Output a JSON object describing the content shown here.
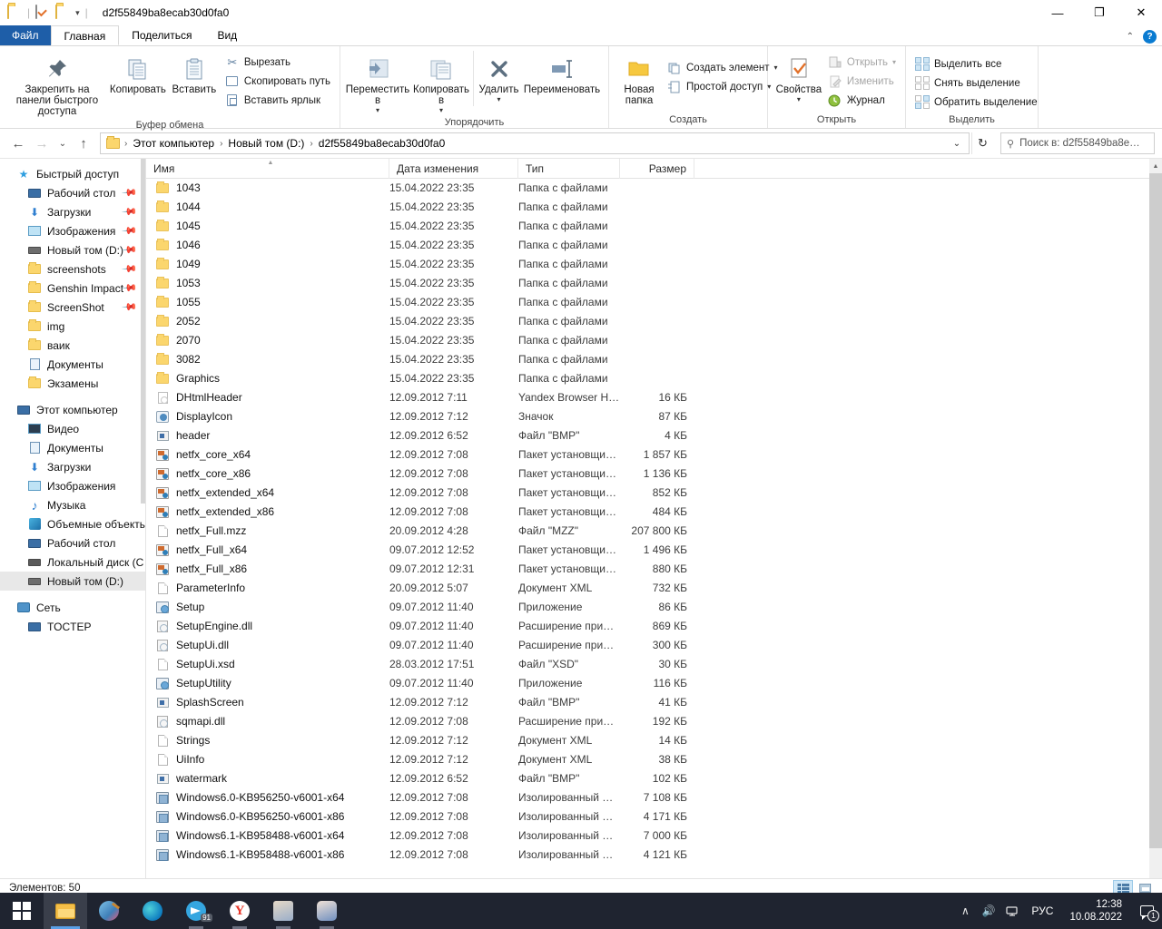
{
  "window": {
    "title": "d2f55849ba8ecab30d0fa0",
    "minimize": "—",
    "maximize": "❐",
    "close": "✕",
    "ribbon_collapse": "⌃",
    "help": "?"
  },
  "quick_access": {
    "folder_icon": "folder-icon",
    "properties_icon": "properties-icon",
    "new_folder_icon": "new-folder-icon",
    "customize_caret": "▾",
    "sep": "|"
  },
  "tabs": [
    {
      "label": "Файл",
      "name": "tab-file"
    },
    {
      "label": "Главная",
      "name": "tab-home"
    },
    {
      "label": "Поделиться",
      "name": "tab-share"
    },
    {
      "label": "Вид",
      "name": "tab-view"
    }
  ],
  "ribbon": {
    "groups": [
      {
        "name": "clipboard",
        "label": "Буфер обмена",
        "big": [
          {
            "label": "Закрепить на панели быстрого доступа",
            "icon": "pin-icon"
          },
          {
            "label": "Копировать",
            "icon": "copy-icon"
          },
          {
            "label": "Вставить",
            "icon": "paste-icon"
          }
        ],
        "small": [
          {
            "label": "Вырезать",
            "icon": "scissors-icon"
          },
          {
            "label": "Скопировать путь",
            "icon": "copy-path-icon"
          },
          {
            "label": "Вставить ярлык",
            "icon": "paste-shortcut-icon"
          }
        ]
      },
      {
        "name": "organize",
        "label": "Упорядочить",
        "big": [
          {
            "label": "Переместить в",
            "icon": "move-to-icon",
            "caret": "▾"
          },
          {
            "label": "Копировать в",
            "icon": "copy-to-icon",
            "caret": "▾"
          },
          {
            "label": "Удалить",
            "icon": "delete-icon",
            "caret": "▾"
          },
          {
            "label": "Переименовать",
            "icon": "rename-icon"
          }
        ]
      },
      {
        "name": "new",
        "label": "Создать",
        "big": [
          {
            "label": "Новая папка",
            "icon": "new-folder-icon"
          }
        ],
        "small": [
          {
            "label": "Создать элемент",
            "icon": "new-item-icon",
            "caret": "▾"
          },
          {
            "label": "Простой доступ",
            "icon": "easy-access-icon",
            "caret": "▾"
          }
        ]
      },
      {
        "name": "open",
        "label": "Открыть",
        "big": [
          {
            "label": "Свойства",
            "icon": "properties-icon",
            "caret": "▾"
          }
        ],
        "small": [
          {
            "label": "Открыть",
            "icon": "open-icon",
            "caret": "▾",
            "disabled": true
          },
          {
            "label": "Изменить",
            "icon": "edit-icon",
            "disabled": true
          },
          {
            "label": "Журнал",
            "icon": "history-icon"
          }
        ]
      },
      {
        "name": "select",
        "label": "Выделить",
        "small": [
          {
            "label": "Выделить все",
            "icon": "select-all-icon"
          },
          {
            "label": "Снять выделение",
            "icon": "select-none-icon"
          },
          {
            "label": "Обратить выделение",
            "icon": "invert-selection-icon"
          }
        ]
      }
    ]
  },
  "navbar": {
    "back_icon": "←",
    "forward_icon": "→",
    "recent_icon": "⌄",
    "up_icon": "↑",
    "breadcrumbs": [
      "Этот компьютер",
      "Новый том (D:)",
      "d2f55849ba8ecab30d0fa0"
    ],
    "sep": "›",
    "dropdown_icon": "⌄",
    "refresh_icon": "↻"
  },
  "search": {
    "placeholder": "Поиск в: d2f55849ba8e…",
    "icon": "search-icon"
  },
  "sidebar": {
    "groups": [
      {
        "name": "quick-access",
        "header": {
          "label": "Быстрый доступ",
          "icon": "star-icon"
        },
        "items": [
          {
            "label": "Рабочий стол",
            "icon": "desktop-icon",
            "pinned": true
          },
          {
            "label": "Загрузки",
            "icon": "downloads-icon",
            "pinned": true
          },
          {
            "label": "Изображения",
            "icon": "pictures-icon",
            "pinned": true
          },
          {
            "label": "Новый том (D:)",
            "icon": "drive-icon",
            "pinned": true
          },
          {
            "label": "screenshots",
            "icon": "folder-icon",
            "pinned": true
          },
          {
            "label": "Genshin Impact",
            "icon": "folder-icon",
            "pinned": true
          },
          {
            "label": "ScreenShot",
            "icon": "folder-icon",
            "pinned": true
          },
          {
            "label": "img",
            "icon": "folder-icon",
            "pinned": false
          },
          {
            "label": "ваик",
            "icon": "folder-icon",
            "pinned": false
          },
          {
            "label": "Документы",
            "icon": "documents-icon",
            "pinned": false
          },
          {
            "label": "Экзамены",
            "icon": "folder-icon",
            "pinned": false
          }
        ]
      },
      {
        "name": "this-pc",
        "header": {
          "label": "Этот компьютер",
          "icon": "pc-icon"
        },
        "items": [
          {
            "label": "Видео",
            "icon": "videos-icon"
          },
          {
            "label": "Документы",
            "icon": "documents-icon"
          },
          {
            "label": "Загрузки",
            "icon": "downloads-icon"
          },
          {
            "label": "Изображения",
            "icon": "pictures-icon"
          },
          {
            "label": "Музыка",
            "icon": "music-icon"
          },
          {
            "label": "Объемные объекты",
            "icon": "3d-objects-icon"
          },
          {
            "label": "Рабочий стол",
            "icon": "desktop-icon"
          },
          {
            "label": "Локальный диск (C",
            "icon": "local-disk-icon"
          },
          {
            "label": "Новый том (D:)",
            "icon": "drive-icon",
            "selected": true
          }
        ]
      },
      {
        "name": "network",
        "header": {
          "label": "Сеть",
          "icon": "network-icon"
        },
        "items": [
          {
            "label": "TOCTEP",
            "icon": "pc-icon"
          }
        ]
      }
    ]
  },
  "filelist": {
    "columns": [
      {
        "label": "Имя",
        "key": "name",
        "sorted": true
      },
      {
        "label": "Дата изменения",
        "key": "date"
      },
      {
        "label": "Тип",
        "key": "type"
      },
      {
        "label": "Размер",
        "key": "size"
      }
    ],
    "rows": [
      {
        "name": "1043",
        "date": "15.04.2022 23:35",
        "type": "Папка с файлами",
        "size": "",
        "icon": "folder"
      },
      {
        "name": "1044",
        "date": "15.04.2022 23:35",
        "type": "Папка с файлами",
        "size": "",
        "icon": "folder"
      },
      {
        "name": "1045",
        "date": "15.04.2022 23:35",
        "type": "Папка с файлами",
        "size": "",
        "icon": "folder"
      },
      {
        "name": "1046",
        "date": "15.04.2022 23:35",
        "type": "Папка с файлами",
        "size": "",
        "icon": "folder"
      },
      {
        "name": "1049",
        "date": "15.04.2022 23:35",
        "type": "Папка с файлами",
        "size": "",
        "icon": "folder"
      },
      {
        "name": "1053",
        "date": "15.04.2022 23:35",
        "type": "Папка с файлами",
        "size": "",
        "icon": "folder"
      },
      {
        "name": "1055",
        "date": "15.04.2022 23:35",
        "type": "Папка с файлами",
        "size": "",
        "icon": "folder"
      },
      {
        "name": "2052",
        "date": "15.04.2022 23:35",
        "type": "Папка с файлами",
        "size": "",
        "icon": "folder"
      },
      {
        "name": "2070",
        "date": "15.04.2022 23:35",
        "type": "Папка с файлами",
        "size": "",
        "icon": "folder"
      },
      {
        "name": "3082",
        "date": "15.04.2022 23:35",
        "type": "Папка с файлами",
        "size": "",
        "icon": "folder"
      },
      {
        "name": "Graphics",
        "date": "15.04.2022 23:35",
        "type": "Папка с файлами",
        "size": "",
        "icon": "folder"
      },
      {
        "name": "DHtmlHeader",
        "date": "12.09.2012 7:11",
        "type": "Yandex Browser H…",
        "size": "16 КБ",
        "icon": "html"
      },
      {
        "name": "DisplayIcon",
        "date": "12.09.2012 7:12",
        "type": "Значок",
        "size": "87 КБ",
        "icon": "ico"
      },
      {
        "name": "header",
        "date": "12.09.2012 6:52",
        "type": "Файл \"BMP\"",
        "size": "4 КБ",
        "icon": "bmp"
      },
      {
        "name": "netfx_core_x64",
        "date": "12.09.2012 7:08",
        "type": "Пакет установщи…",
        "size": "1 857 КБ",
        "icon": "msi"
      },
      {
        "name": "netfx_core_x86",
        "date": "12.09.2012 7:08",
        "type": "Пакет установщи…",
        "size": "1 136 КБ",
        "icon": "msi"
      },
      {
        "name": "netfx_extended_x64",
        "date": "12.09.2012 7:08",
        "type": "Пакет установщи…",
        "size": "852 КБ",
        "icon": "msi"
      },
      {
        "name": "netfx_extended_x86",
        "date": "12.09.2012 7:08",
        "type": "Пакет установщи…",
        "size": "484 КБ",
        "icon": "msi"
      },
      {
        "name": "netfx_Full.mzz",
        "date": "20.09.2012 4:28",
        "type": "Файл \"MZZ\"",
        "size": "207 800 КБ",
        "icon": "doc"
      },
      {
        "name": "netfx_Full_x64",
        "date": "09.07.2012 12:52",
        "type": "Пакет установщи…",
        "size": "1 496 КБ",
        "icon": "msi"
      },
      {
        "name": "netfx_Full_x86",
        "date": "09.07.2012 12:31",
        "type": "Пакет установщи…",
        "size": "880 КБ",
        "icon": "msi"
      },
      {
        "name": "ParameterInfo",
        "date": "20.09.2012 5:07",
        "type": "Документ XML",
        "size": "732 КБ",
        "icon": "doc"
      },
      {
        "name": "Setup",
        "date": "09.07.2012 11:40",
        "type": "Приложение",
        "size": "86 КБ",
        "icon": "exe"
      },
      {
        "name": "SetupEngine.dll",
        "date": "09.07.2012 11:40",
        "type": "Расширение при…",
        "size": "869 КБ",
        "icon": "dll"
      },
      {
        "name": "SetupUi.dll",
        "date": "09.07.2012 11:40",
        "type": "Расширение при…",
        "size": "300 КБ",
        "icon": "dll"
      },
      {
        "name": "SetupUi.xsd",
        "date": "28.03.2012 17:51",
        "type": "Файл \"XSD\"",
        "size": "30 КБ",
        "icon": "doc"
      },
      {
        "name": "SetupUtility",
        "date": "09.07.2012 11:40",
        "type": "Приложение",
        "size": "116 КБ",
        "icon": "exe"
      },
      {
        "name": "SplashScreen",
        "date": "12.09.2012 7:12",
        "type": "Файл \"BMP\"",
        "size": "41 КБ",
        "icon": "bmp"
      },
      {
        "name": "sqmapi.dll",
        "date": "12.09.2012 7:08",
        "type": "Расширение при…",
        "size": "192 КБ",
        "icon": "dll"
      },
      {
        "name": "Strings",
        "date": "12.09.2012 7:12",
        "type": "Документ XML",
        "size": "14 КБ",
        "icon": "doc"
      },
      {
        "name": "UiInfo",
        "date": "12.09.2012 7:12",
        "type": "Документ XML",
        "size": "38 КБ",
        "icon": "doc"
      },
      {
        "name": "watermark",
        "date": "12.09.2012 6:52",
        "type": "Файл \"BMP\"",
        "size": "102 КБ",
        "icon": "bmp"
      },
      {
        "name": "Windows6.0-KB956250-v6001-x64",
        "date": "12.09.2012 7:08",
        "type": "Изолированный …",
        "size": "7 108 КБ",
        "icon": "cab"
      },
      {
        "name": "Windows6.0-KB956250-v6001-x86",
        "date": "12.09.2012 7:08",
        "type": "Изолированный …",
        "size": "4 171 КБ",
        "icon": "cab"
      },
      {
        "name": "Windows6.1-KB958488-v6001-x64",
        "date": "12.09.2012 7:08",
        "type": "Изолированный …",
        "size": "7 000 КБ",
        "icon": "cab"
      },
      {
        "name": "Windows6.1-KB958488-v6001-x86",
        "date": "12.09.2012 7:08",
        "type": "Изолированный …",
        "size": "4 121 КБ",
        "icon": "cab"
      }
    ]
  },
  "statusbar": {
    "count_label": "Элементов: 50",
    "views": [
      {
        "name": "details-view-button",
        "icon": "details-view-icon",
        "active": true
      },
      {
        "name": "large-icons-view-button",
        "icon": "large-icons-view-icon",
        "active": false
      }
    ]
  },
  "taskbar": {
    "start": {
      "name": "start-button",
      "icon": "windows-logo-icon"
    },
    "items": [
      {
        "name": "taskbar-file-explorer",
        "icon": "explorer-icon",
        "active": true
      },
      {
        "name": "taskbar-paint",
        "icon": "paint-icon",
        "running": false
      },
      {
        "name": "taskbar-edge",
        "icon": "edge-icon",
        "running": false
      },
      {
        "name": "taskbar-telegram",
        "icon": "telegram-icon",
        "running": true,
        "badge": "91"
      },
      {
        "name": "taskbar-yandex-browser",
        "icon": "yandex-icon",
        "running": true
      },
      {
        "name": "taskbar-game-1",
        "icon": "game-icon",
        "running": true
      },
      {
        "name": "taskbar-game-2",
        "icon": "game-icon",
        "running": true
      }
    ],
    "tray": {
      "chevron": "∧",
      "volume_icon": "volume-icon",
      "network_icon": "network-icon",
      "language": "РУС",
      "time": "12:38",
      "date": "10.08.2022",
      "notification_count": "1"
    }
  }
}
